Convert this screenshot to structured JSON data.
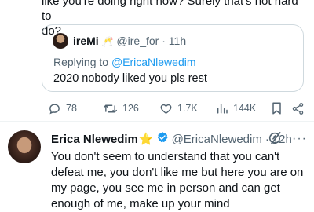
{
  "previous_tweet": {
    "text": "like you're doing right now? Surely that's not hard to\ndo?"
  },
  "quoted_tweet": {
    "name": "ireMi",
    "emoji": "🥂",
    "handle": "@ire_for",
    "time": "11h",
    "replying_label": "Replying to",
    "replying_to": "@EricaNlewedim",
    "text": "2020 nobody liked you pls rest"
  },
  "actions": {
    "replies": "78",
    "retweets": "126",
    "likes": "1.7K",
    "views": "144K"
  },
  "tweet": {
    "name": "Erica Nlewedim",
    "badge": "⭐",
    "handle": "@EricaNlewedim",
    "time": "12h",
    "text": "You don't seem to understand that you can't defeat me, you don't like me but here you are on my page, you see me in person and can get enough of me, make up your mind"
  },
  "colors": {
    "accent": "#1d9bf0",
    "muted": "#536471",
    "border": "#cfd9de",
    "star": "#f4b400"
  },
  "icons": [
    "reply-icon",
    "retweet-icon",
    "like-icon",
    "views-icon",
    "bookmark-icon",
    "share-icon",
    "verified-icon",
    "grok-icon",
    "more-icon"
  ]
}
